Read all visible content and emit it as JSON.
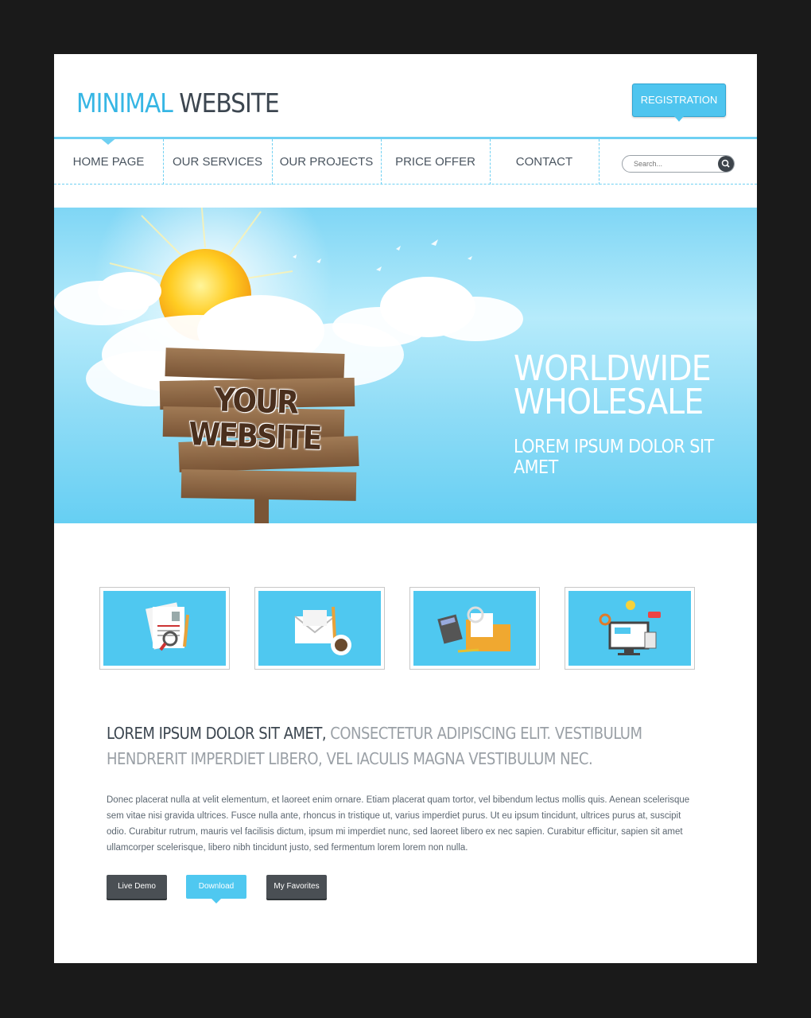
{
  "header": {
    "logo_part1": "MINIMAL",
    "logo_part2": "WEBSITE",
    "registration_label": "REGISTRATION"
  },
  "nav": {
    "items": [
      {
        "label": "HOME PAGE"
      },
      {
        "label": "OUR SERVICES"
      },
      {
        "label": "OUR PROJECTS"
      },
      {
        "label": "PRICE OFFER"
      },
      {
        "label": "CONTACT"
      }
    ],
    "active": "HOME PAGE",
    "search_placeholder": "Search..."
  },
  "hero": {
    "sign_text_line1": "YOUR",
    "sign_text_line2": "WEBSITE",
    "title": "WORLDWIDE\nWHOLESALE",
    "subtitle": "LOREM IPSUM DOLOR SIT AMET"
  },
  "thumbnails": [
    {
      "icon": "documents-search-icon"
    },
    {
      "icon": "mail-coffee-icon"
    },
    {
      "icon": "calculator-folder-icon"
    },
    {
      "icon": "computer-ideas-icon"
    }
  ],
  "content": {
    "headline_dark": "LOREM IPSUM DOLOR SIT AMET,",
    "headline_light": " CONSECTETUR ADIPISCING ELIT. VESTIBULUM HENDRERIT IMPERDIET LIBERO, VEL IACULIS MAGNA VESTIBULUM NEC.",
    "body": "Donec placerat nulla at velit elementum, et laoreet enim ornare. Etiam placerat quam tortor, vel bibendum lectus mollis quis. Aenean scelerisque sem vitae nisi gravida ultrices. Fusce nulla ante, rhoncus in tristique ut, varius imperdiet purus. Ut eu ipsum tincidunt, ultrices purus at, suscipit odio. Curabitur rutrum, mauris vel facilisis dictum, ipsum mi imperdiet nunc, sed laoreet libero ex nec sapien. Curabitur efficitur, sapien sit amet ullamcorper scelerisque, libero nibh tincidunt justo, sed fermentum lorem lorem non nulla."
  },
  "buttons": {
    "live_demo": "Live Demo",
    "download": "Download",
    "favorites": "My Favorites"
  },
  "colors": {
    "accent": "#4fc5ef",
    "dark_text": "#3c4650",
    "frame": "#1a1a1a"
  }
}
